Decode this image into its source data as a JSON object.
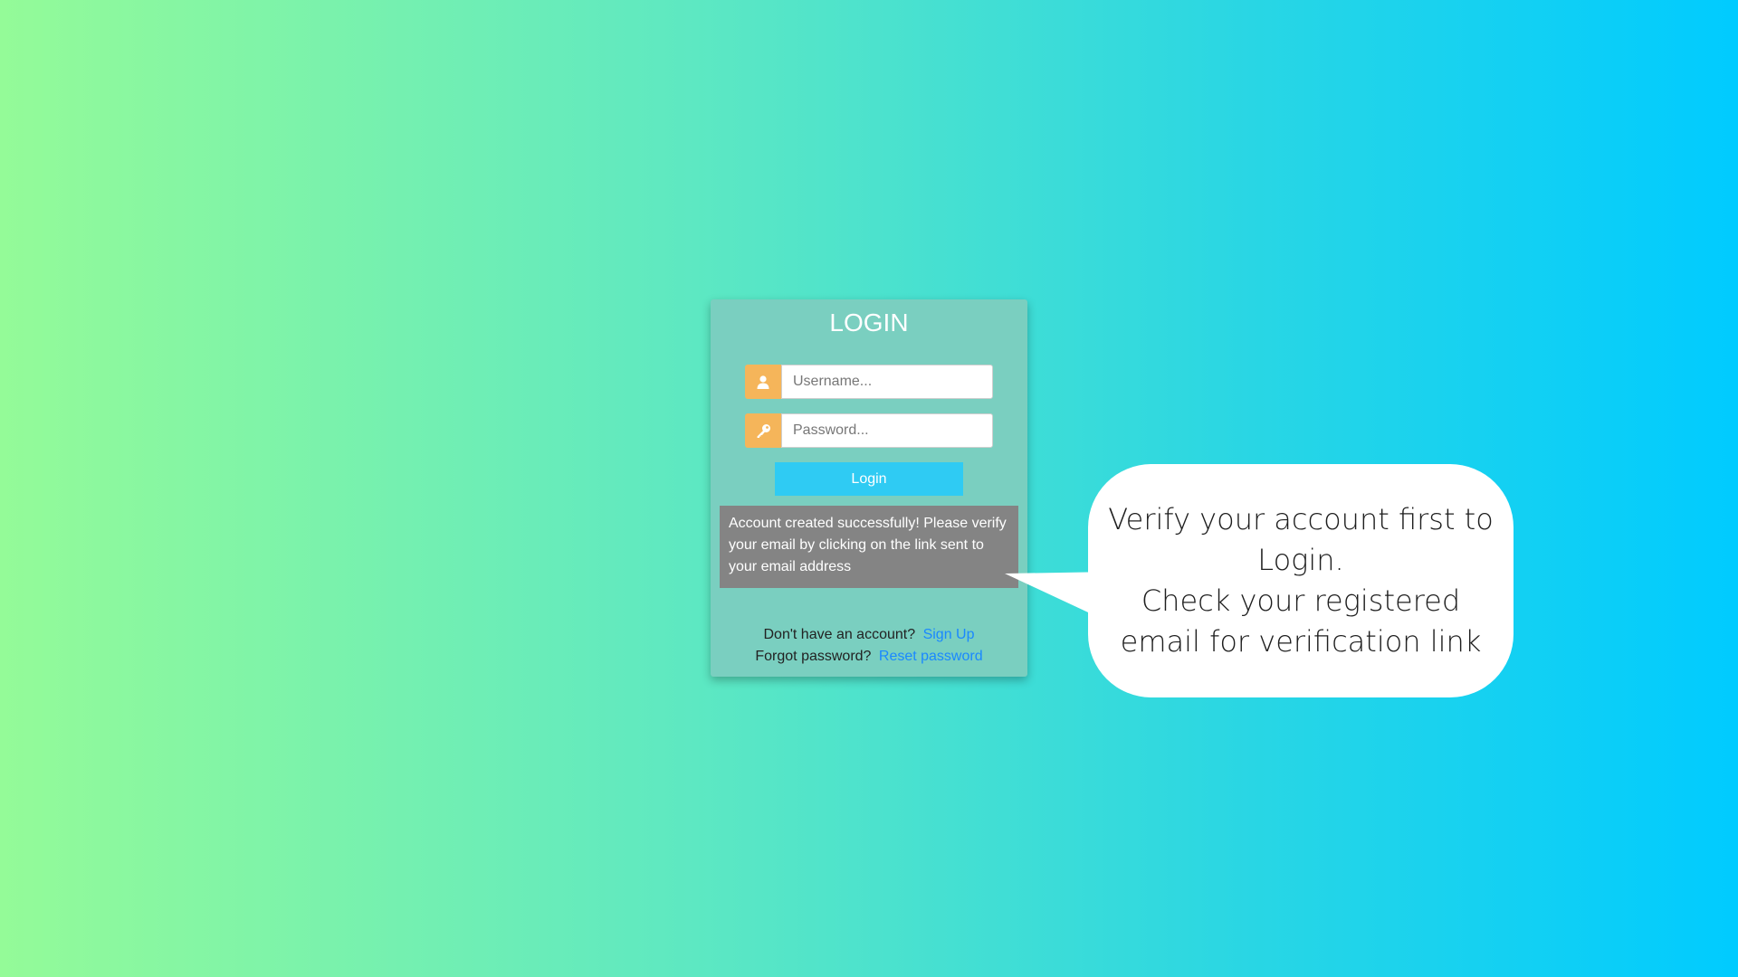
{
  "login": {
    "title": "LOGIN",
    "username_placeholder": "Username...",
    "password_placeholder": "Password...",
    "button_label": "Login",
    "username_icon": "user-icon",
    "password_icon": "key-icon",
    "alert_message": "Account created successfully! Please verify your email by clicking on the link sent to your email address",
    "signup_prompt": "Don't have an account?",
    "signup_link": "Sign Up",
    "reset_prompt": "Forgot password?",
    "reset_link": "Reset password"
  },
  "callout": {
    "lines": [
      "Verify your account first to",
      "Login.",
      "Check your registered",
      "email for verification link"
    ]
  },
  "colors": {
    "background_gradient": [
      "#94fb98",
      "#00cbff"
    ],
    "card": "#7acfc0",
    "icon_box": "#f5b55a",
    "button": "#2fcbf3",
    "alert": "#848484",
    "link": "#1a88ff",
    "bubble": "#ffffff"
  }
}
